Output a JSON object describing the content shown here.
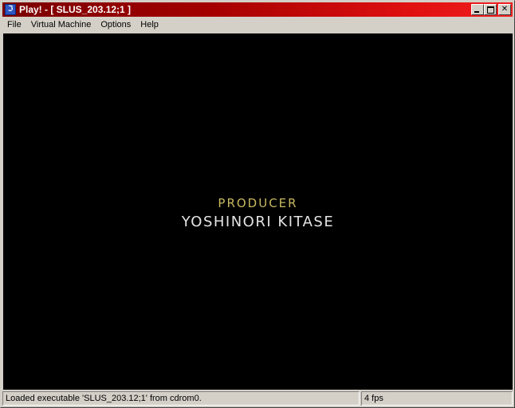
{
  "window": {
    "title": "Play! - [ SLUS_203.12;1 ]",
    "app_icon_glyph": "ℑ",
    "buttons": {
      "minimize": "minimize",
      "maximize": "maximize",
      "close_glyph": "✕"
    }
  },
  "menu": {
    "items": [
      {
        "label": "File"
      },
      {
        "label": "Virtual Machine"
      },
      {
        "label": "Options"
      },
      {
        "label": "Help"
      }
    ]
  },
  "screen": {
    "role": "PRODUCER",
    "name": "YOSHINORI KITASE"
  },
  "status": {
    "message": "Loaded executable 'SLUS_203.12;1' from cdrom0.",
    "fps": "4 fps"
  },
  "colors": {
    "titlebar_start": "#7a0000",
    "titlebar_end": "#f22020",
    "role_text": "#c8b860",
    "name_text": "#e4e4e4"
  }
}
